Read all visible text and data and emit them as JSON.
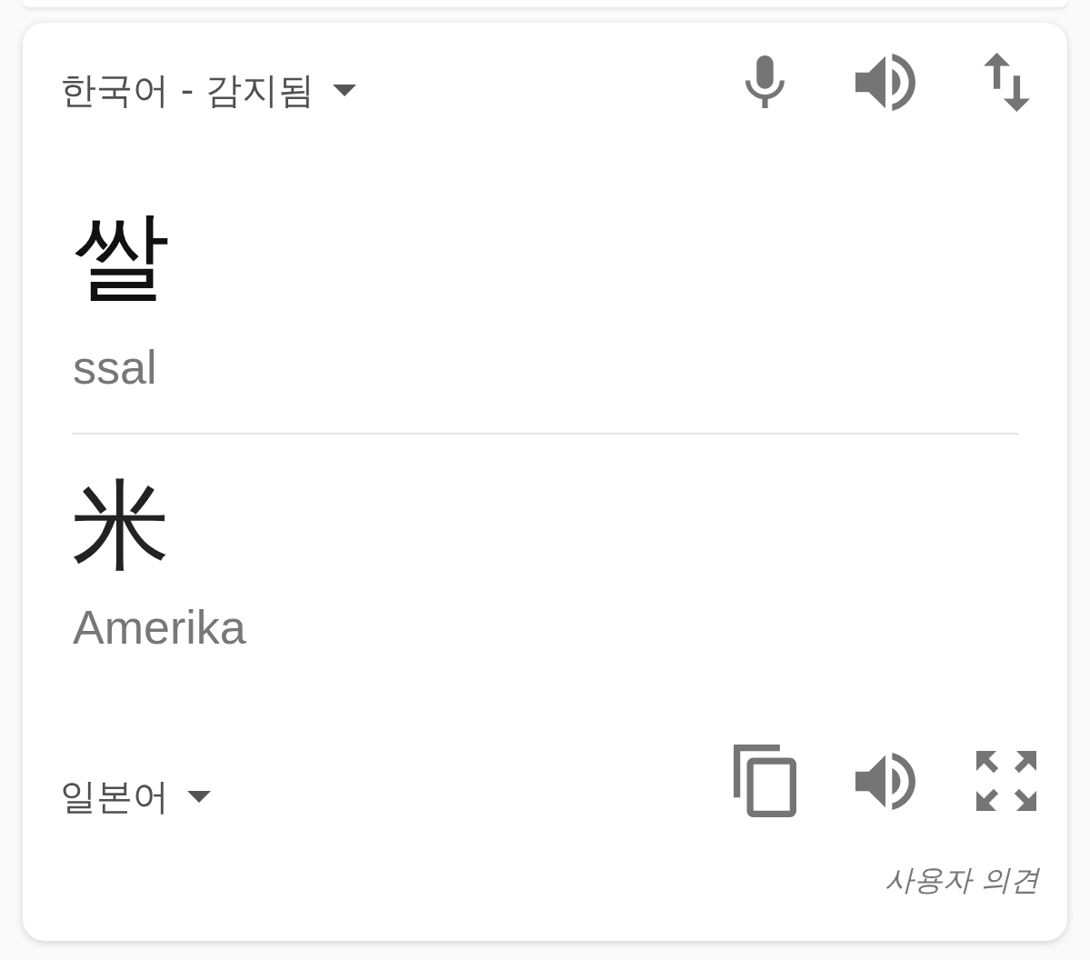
{
  "source_language": {
    "label": "한국어 - 감지됨"
  },
  "source_text": "쌀",
  "source_romanization": "ssal",
  "translated_text": "米",
  "translated_romanization": "Amerika",
  "target_language": {
    "label": "일본어"
  },
  "feedback_link": "사용자 의견"
}
